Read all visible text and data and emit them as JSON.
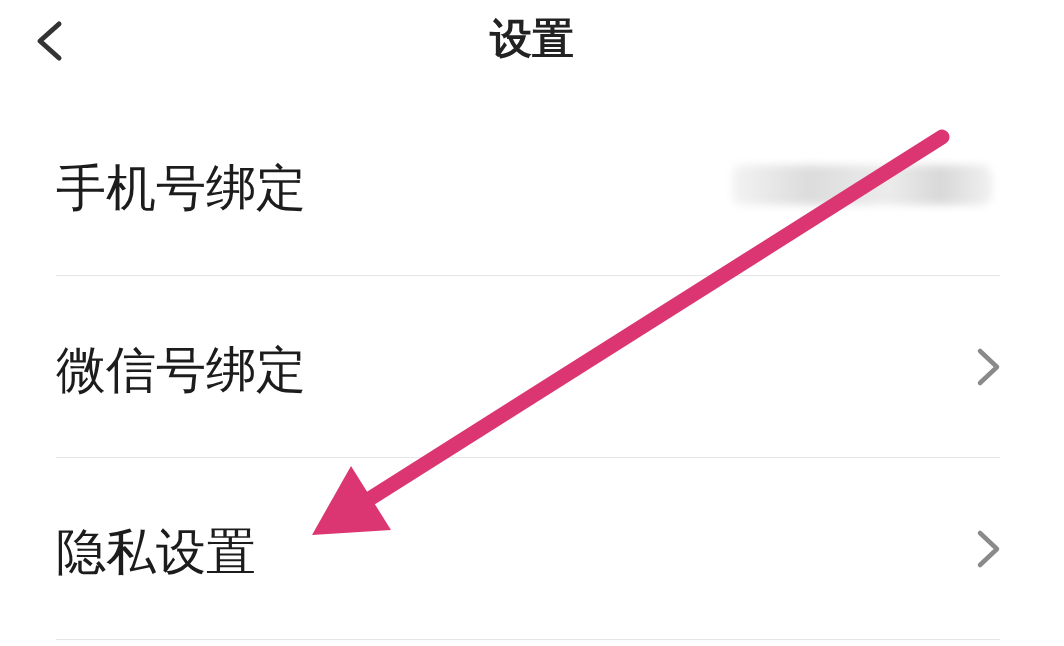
{
  "header": {
    "title": "设置"
  },
  "rows": [
    {
      "label": "手机号绑定",
      "kind": "masked"
    },
    {
      "label": "微信号绑定",
      "kind": "link"
    },
    {
      "label": "隐私设置",
      "kind": "link"
    }
  ]
}
